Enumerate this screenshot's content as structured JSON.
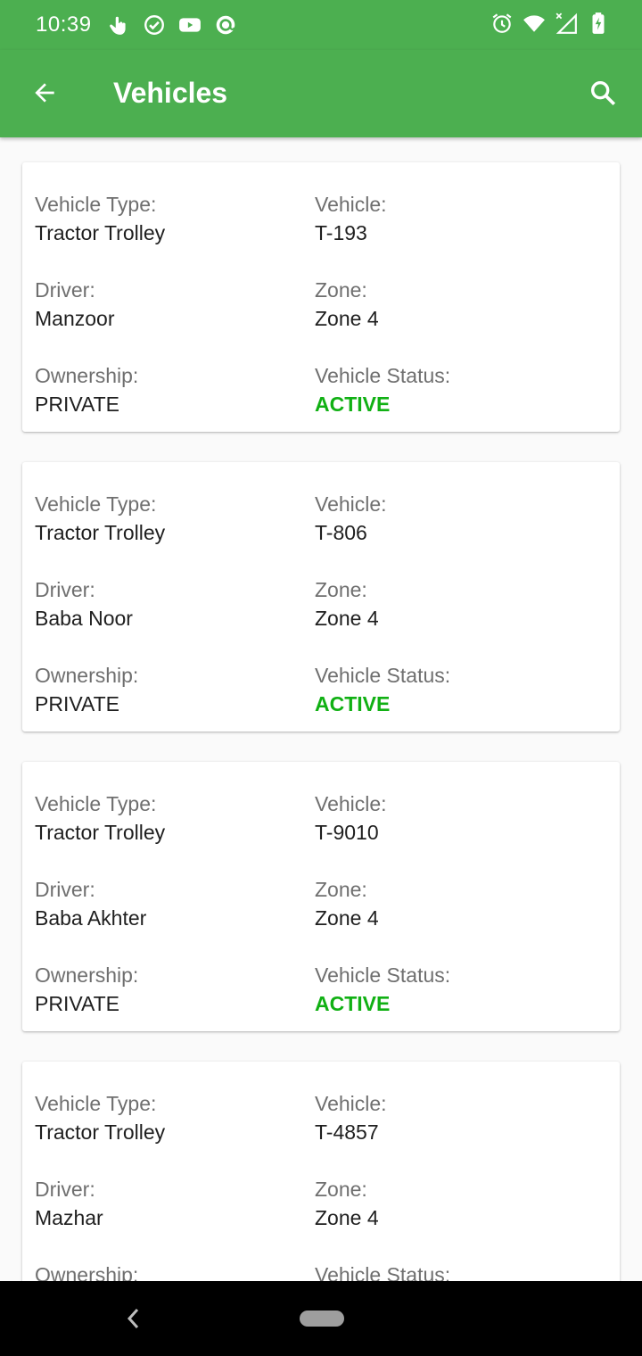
{
  "status_bar": {
    "time": "10:39",
    "left_icons": [
      "touch-icon",
      "check-circle-icon",
      "youtube-icon",
      "at-sign-icon"
    ],
    "right_icons": [
      "alarm-icon",
      "wifi-icon",
      "signal-icon",
      "battery-icon"
    ]
  },
  "app_bar": {
    "title": "Vehicles",
    "back_icon": "arrow-left-icon",
    "search_icon": "search-icon",
    "color": "#4caf50"
  },
  "labels": {
    "vehicle_type": "Vehicle Type:",
    "vehicle": "Vehicle:",
    "driver": "Driver:",
    "zone": "Zone:",
    "ownership": "Ownership:",
    "vehicle_status": "Vehicle Status:"
  },
  "vehicles": [
    {
      "vehicle_type": "Tractor Trolley",
      "vehicle": "T-193",
      "driver": "Manzoor",
      "zone": "Zone 4",
      "ownership": "PRIVATE",
      "status": "ACTIVE"
    },
    {
      "vehicle_type": "Tractor Trolley",
      "vehicle": "T-806",
      "driver": "Baba Noor",
      "zone": "Zone 4",
      "ownership": "PRIVATE",
      "status": "ACTIVE"
    },
    {
      "vehicle_type": "Tractor Trolley",
      "vehicle": "T-9010",
      "driver": "Baba Akhter",
      "zone": "Zone 4",
      "ownership": "PRIVATE",
      "status": "ACTIVE"
    },
    {
      "vehicle_type": "Tractor Trolley",
      "vehicle": "T-4857",
      "driver": "Mazhar",
      "zone": "Zone 4",
      "ownership": "",
      "status": ""
    }
  ],
  "colors": {
    "status_active": "#11b014",
    "label": "#6f6f6f"
  },
  "nav_bar": {
    "back_icon": "nav-back-icon",
    "home_icon": "home-pill-icon"
  }
}
